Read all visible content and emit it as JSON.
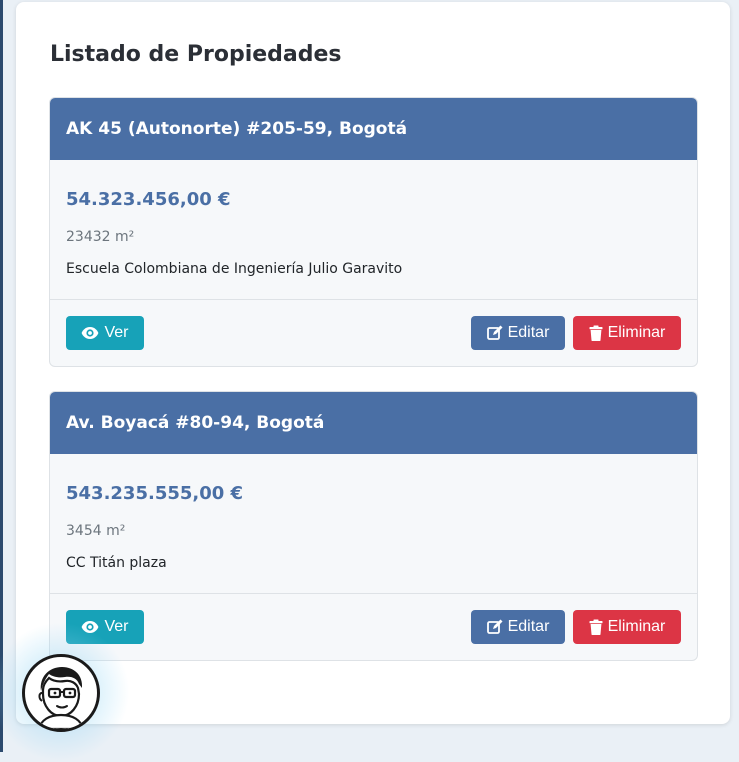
{
  "page": {
    "title": "Listado de Propiedades"
  },
  "properties": [
    {
      "address": "AK 45 (Autonorte) #205-59, Bogotá",
      "price": "54.323.456,00 €",
      "area": "23432 m²",
      "description": "Escuela Colombiana de Ingeniería Julio Garavito"
    },
    {
      "address": "Av. Boyacá #80-94, Bogotá",
      "price": "543.235.555,00 €",
      "area": "3454 m²",
      "description": "CC Titán plaza"
    }
  ],
  "actions": {
    "view_label": "Ver",
    "edit_label": "Editar",
    "delete_label": "Eliminar"
  },
  "icons": {
    "view": "eye-icon",
    "edit": "edit-icon",
    "delete": "trash-icon",
    "avatar": "avatar-icon"
  },
  "colors": {
    "header": "#4a6fa5",
    "price": "#4a6fa5",
    "view_button": "#17a2b8",
    "edit_button": "#4a6fa5",
    "delete_button": "#dc3545"
  }
}
